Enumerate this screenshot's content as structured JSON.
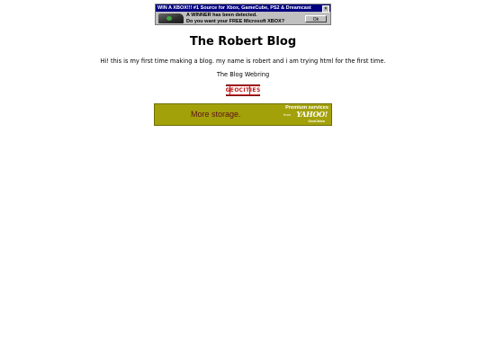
{
  "top_ad": {
    "title": "WIN A XBOX!!! #1 Source for Xbox, GameCube, PS2 & Dreamcast",
    "close_glyph": "×",
    "line1": "A WINNER has been detected.",
    "line2": "Do you want your FREE Microsoft XBOX?",
    "ok_label": "Ok",
    "icon": "xbox-console-icon"
  },
  "page": {
    "title": "The Robert Blog",
    "intro": "Hi! this is my first time making a blog. my name is robert and i am trying html for the first time.",
    "webring_label": "The Blog Webring"
  },
  "geocities_logo": {
    "letters": [
      "G",
      "E",
      "O",
      "C",
      "I",
      "T",
      "I",
      "E",
      "S"
    ],
    "color": "#c41a1a"
  },
  "bottom_ad": {
    "headline": "More storage.",
    "premium": "Premium services",
    "from": "from",
    "brand": "YAHOO!",
    "sub_brand": "GeoCities",
    "background": "#a3a10a"
  }
}
